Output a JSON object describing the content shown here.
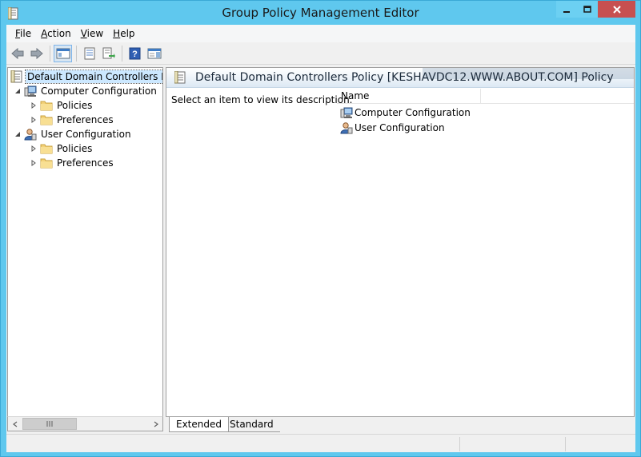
{
  "window": {
    "title": "Group Policy Management Editor"
  },
  "menu": {
    "items": [
      {
        "label": "File",
        "mnemonic": "F",
        "rest": "ile"
      },
      {
        "label": "Action",
        "mnemonic": "A",
        "rest": "ction"
      },
      {
        "label": "View",
        "mnemonic": "V",
        "rest": "iew"
      },
      {
        "label": "Help",
        "mnemonic": "H",
        "rest": "elp"
      }
    ]
  },
  "toolbar": {
    "buttons": [
      "back-arrow-icon",
      "forward-arrow-icon",
      "show-hide-console-tree-icon",
      "properties-icon",
      "export-list-icon",
      "help-icon",
      "show-hide-action-pane-icon"
    ]
  },
  "tree": {
    "root": "Default Domain Controllers Poli",
    "computer": "Computer Configuration",
    "computer_policies": "Policies",
    "computer_preferences": "Preferences",
    "user": "User Configuration",
    "user_policies": "Policies",
    "user_preferences": "Preferences"
  },
  "right_pane": {
    "header_title": "Default Domain Controllers Policy [KESHAVDC12.WWW.ABOUT.COM] Policy",
    "description": "Select an item to view its description.",
    "column_name": "Name",
    "items": [
      "Computer Configuration",
      "User Configuration"
    ]
  },
  "tabs": {
    "extended": "Extended",
    "standard": "Standard"
  },
  "colors": {
    "title_bar": "#5fc8ee",
    "close_button": "#c75050",
    "selection": "#cce8ff"
  }
}
